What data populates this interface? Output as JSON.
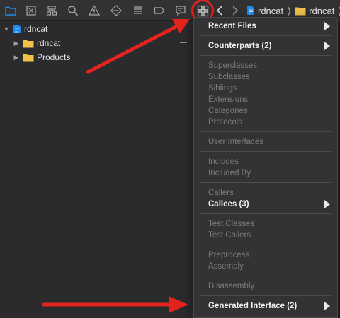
{
  "toolbar": {
    "navigator_icons": [
      "folder-icon",
      "source-control-icon",
      "hierarchy-icon",
      "find-icon",
      "issue-icon",
      "test-icon",
      "debug-icon",
      "breakpoint-icon",
      "report-icon"
    ],
    "related_items_icon": "related-items-icon",
    "back_icon": "chevron-left-icon",
    "forward_icon": "chevron-right-icon"
  },
  "jump_bar": {
    "project": "rdncat",
    "group": "rdncat"
  },
  "navigator": {
    "project": "rdncat",
    "groups": [
      "rdncat",
      "Products"
    ]
  },
  "menu": {
    "sections": [
      [
        {
          "label": "Recent Files",
          "enabled": true,
          "submenu": true
        }
      ],
      [
        {
          "label": "Counterparts (2)",
          "enabled": true,
          "submenu": true
        }
      ],
      [
        {
          "label": "Superclasses",
          "enabled": false,
          "submenu": false
        },
        {
          "label": "Subclasses",
          "enabled": false,
          "submenu": false
        },
        {
          "label": "Siblings",
          "enabled": false,
          "submenu": false
        },
        {
          "label": "Extensions",
          "enabled": false,
          "submenu": false
        },
        {
          "label": "Categories",
          "enabled": false,
          "submenu": false
        },
        {
          "label": "Protocols",
          "enabled": false,
          "submenu": false
        }
      ],
      [
        {
          "label": "User Interfaces",
          "enabled": false,
          "submenu": false
        }
      ],
      [
        {
          "label": "Includes",
          "enabled": false,
          "submenu": false
        },
        {
          "label": "Included By",
          "enabled": false,
          "submenu": false
        }
      ],
      [
        {
          "label": "Callers",
          "enabled": false,
          "submenu": false
        },
        {
          "label": "Callees (3)",
          "enabled": true,
          "submenu": true
        }
      ],
      [
        {
          "label": "Test Classes",
          "enabled": false,
          "submenu": false
        },
        {
          "label": "Test Callers",
          "enabled": false,
          "submenu": false
        }
      ],
      [
        {
          "label": "Preprocess",
          "enabled": false,
          "submenu": false
        },
        {
          "label": "Assembly",
          "enabled": false,
          "submenu": false
        }
      ],
      [
        {
          "label": "Disassembly",
          "enabled": false,
          "submenu": false
        }
      ],
      [
        {
          "label": "Generated Interface (2)",
          "enabled": true,
          "submenu": true
        }
      ]
    ]
  },
  "colors": {
    "accent": "#1a8cf0",
    "annotation": "#e3241d",
    "folder": "#f0c24a"
  }
}
